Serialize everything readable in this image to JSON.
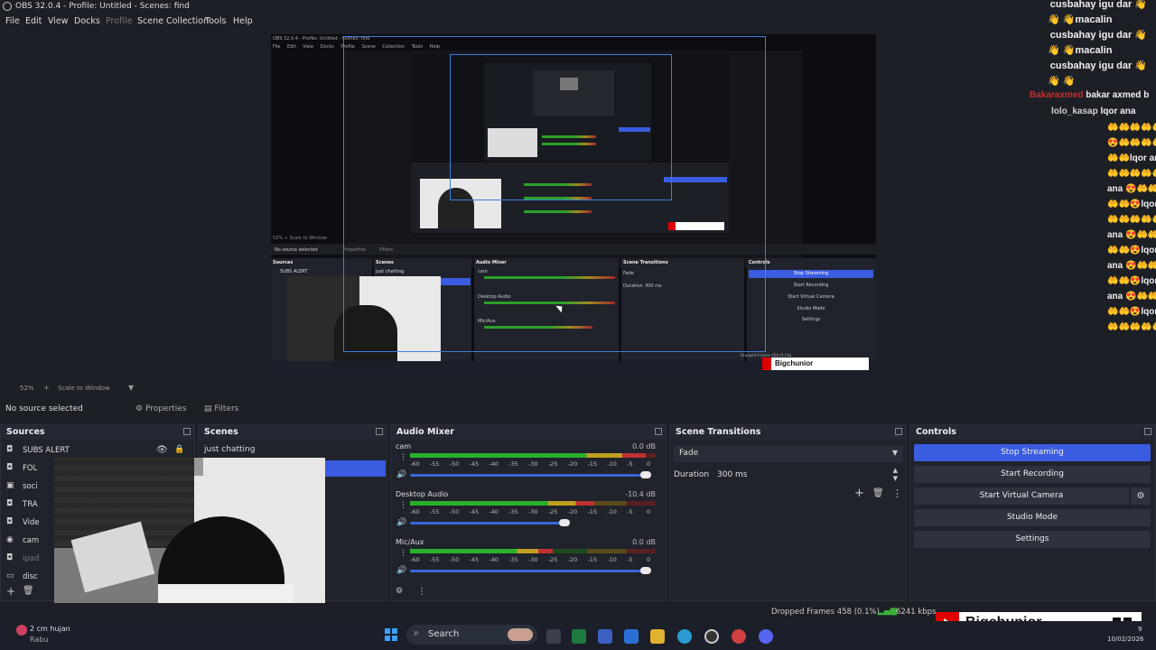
{
  "app": {
    "title": "OBS 32.0.4 - Profile: Untitled - Scenes: find"
  },
  "menu": {
    "items": [
      "File",
      "Edit",
      "View",
      "Docks",
      "Profile",
      "Scene Collection",
      "Tools",
      "Help"
    ]
  },
  "preview_nested": {
    "title": "OBS 32.0.4 - Profile: Untitled - Scenes: find",
    "menu": [
      "File",
      "Edit",
      "View",
      "Docks",
      "Profile",
      "Scene Collection",
      "Tools",
      "Help"
    ],
    "no_source": "No source selected",
    "props": "Properties",
    "filters": "Filters",
    "sources": "Sources",
    "scenes": "Scenes",
    "mixer": "Audio Mixer",
    "transitions": "Scene Transitions",
    "controls": "Controls",
    "src_item": "SUBS ALERT",
    "scene_item": "just chatting",
    "fade": "Fade",
    "duration_label": "Duration",
    "duration_value": "300 ms",
    "ctrl": [
      "Stop Streaming",
      "Start Recording",
      "Start Virtual Camera",
      "Studio Mode",
      "Settings"
    ],
    "ch": [
      "cam",
      "Desktop Audio",
      "Mic/Aux"
    ],
    "banner": "Bigchunior",
    "dropped": "Dropped Frames 458 (0.1%)"
  },
  "chat": [
    {
      "user": "cusbahay igu dar",
      "emoji": "👋"
    },
    {
      "user": "macalin",
      "emoji": "👋 👋"
    },
    {
      "user": "cusbahay igu dar",
      "emoji": "👋"
    },
    {
      "user": "macalin",
      "emoji": "👋 👋"
    },
    {
      "user": "cusbahay igu dar",
      "emoji": "👋"
    },
    {
      "user": "",
      "emoji": "👋 👋"
    }
  ],
  "chat2": [
    {
      "name": "Bakaraxmed",
      "text": "bakar axmed b"
    },
    {
      "name": "lolo_kasap",
      "text": "lqor ana"
    }
  ],
  "chat_emo_lines": [
    "🤲🤲🤲🤲🤲",
    "😍🤲🤲🤲🤲",
    "🤲🤲lqor ana",
    "🤲🤲🤲🤲🤲",
    "ana 😍🤲🤲🤲",
    "🤲🤲😍lqor a",
    "🤲🤲🤲🤲🤲",
    "ana 😍🤲🤲🤲",
    "🤲🤲😍lqor a",
    "ana 😍🤲🤲🤲",
    "🤲🤲😍lqor a",
    "ana 😍🤲🤲🤲",
    "🤲🤲😍lqor a",
    "🤲🤲🤲🤲🤲"
  ],
  "zoom": {
    "value": "52%",
    "scale": "Scale to Window"
  },
  "toolbar": {
    "no_source": "No source selected",
    "properties": "Properties",
    "filters": "Filters"
  },
  "sources": {
    "title": "Sources",
    "items": [
      {
        "label": "SUBS ALERT",
        "icon": "display-icon"
      },
      {
        "label": "FOL",
        "icon": "display-icon"
      },
      {
        "label": "soci",
        "icon": "image-icon"
      },
      {
        "label": "TRA",
        "icon": "display-icon"
      },
      {
        "label": "Vide",
        "icon": "display-icon"
      },
      {
        "label": "cam",
        "icon": "camera-icon"
      },
      {
        "label": "ipad",
        "icon": "display-icon"
      },
      {
        "label": "disc",
        "icon": "window-icon"
      }
    ]
  },
  "scenes": {
    "title": "Scenes",
    "items": [
      "just chatting",
      ""
    ]
  },
  "mixer": {
    "title": "Audio Mixer",
    "scale": [
      "-60",
      "-55",
      "-50",
      "-45",
      "-40",
      "-35",
      "-30",
      "-25",
      "-20",
      "-15",
      "-10",
      "-5",
      "0"
    ],
    "channels": [
      {
        "name": "cam",
        "db": "0.0 dB",
        "level": 0.96,
        "fader": 0.96
      },
      {
        "name": "Desktop Audio",
        "db": "-10.4 dB",
        "level": 0.75,
        "fader": 0.63
      },
      {
        "name": "Mic/Aux",
        "db": "0.0 dB",
        "level": 0.58,
        "fader": 0.96
      }
    ]
  },
  "transitions": {
    "title": "Scene Transitions",
    "selected": "Fade",
    "duration_label": "Duration",
    "duration_value": "300 ms"
  },
  "controls": {
    "title": "Controls",
    "buttons": [
      "Stop Streaming",
      "Start Recording",
      "Start Virtual Camera",
      "Studio Mode",
      "Settings"
    ]
  },
  "status": {
    "dropped": "Dropped Frames 458 (0.1%)",
    "bitrate": "6241 kbps"
  },
  "banner": {
    "name": "Bigchunior"
  },
  "taskbar": {
    "weather_temp": "2 cm hujan",
    "weather_day": "Rabu",
    "search": "Search",
    "date": "10/02/2026",
    "time_partial": "9"
  },
  "colors": {
    "accent": "#3a5ce0",
    "bg": "#1d1f26",
    "panel": "#20232b",
    "youtube": "#e10000"
  }
}
